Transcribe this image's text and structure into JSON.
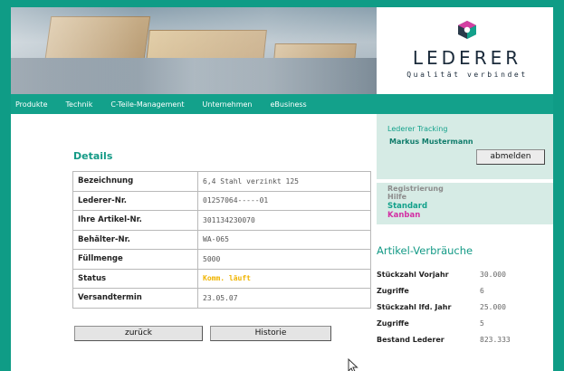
{
  "brand": {
    "name": "LEDERER",
    "slogan": "Qualität verbindet",
    "logo_color_primary": "#2a3a4a",
    "logo_color_accent": "#d43fa2",
    "logo_color_secondary": "#13a18b"
  },
  "nav": {
    "items": [
      "Produkte",
      "Technik",
      "C-Teile-Management",
      "Unternehmen",
      "eBusiness"
    ]
  },
  "details": {
    "title": "Details",
    "rows": [
      {
        "label": "Bezeichnung",
        "value": "6,4 Stahl verzinkt 125"
      },
      {
        "label": "Lederer-Nr.",
        "value": "01257064-----01"
      },
      {
        "label": "Ihre Artikel-Nr.",
        "value": "301134230070"
      },
      {
        "label": "Behälter-Nr.",
        "value": "WA-065"
      },
      {
        "label": "Füllmenge",
        "value": "5000"
      },
      {
        "label": "Status",
        "value": "Komm. läuft"
      },
      {
        "label": "Versandtermin",
        "value": "23.05.07"
      }
    ],
    "status_color": "#f0b400"
  },
  "buttons": {
    "back": "zurück",
    "history": "Historie"
  },
  "sidebar": {
    "tracking_title": "Lederer Tracking",
    "user_name": "Markus Mustermann",
    "logout": "abmelden",
    "registration": "Registrierung",
    "help": "Hilfe",
    "mode_standard": "Standard",
    "mode_kanban": "Kanban"
  },
  "usage": {
    "title": "Artikel-Verbräuche",
    "rows": [
      {
        "label": "Stückzahl Vorjahr",
        "value": "30.000"
      },
      {
        "label": "Zugriffe",
        "value": "6"
      },
      {
        "label": "Stückzahl lfd. Jahr",
        "value": "25.000"
      },
      {
        "label": "Zugriffe",
        "value": "5"
      },
      {
        "label": "Bestand Lederer",
        "value": "823.333"
      }
    ]
  },
  "colors": {
    "accent": "#13a18b",
    "background": "#0f9c86",
    "panel": "#d6ebe5"
  }
}
